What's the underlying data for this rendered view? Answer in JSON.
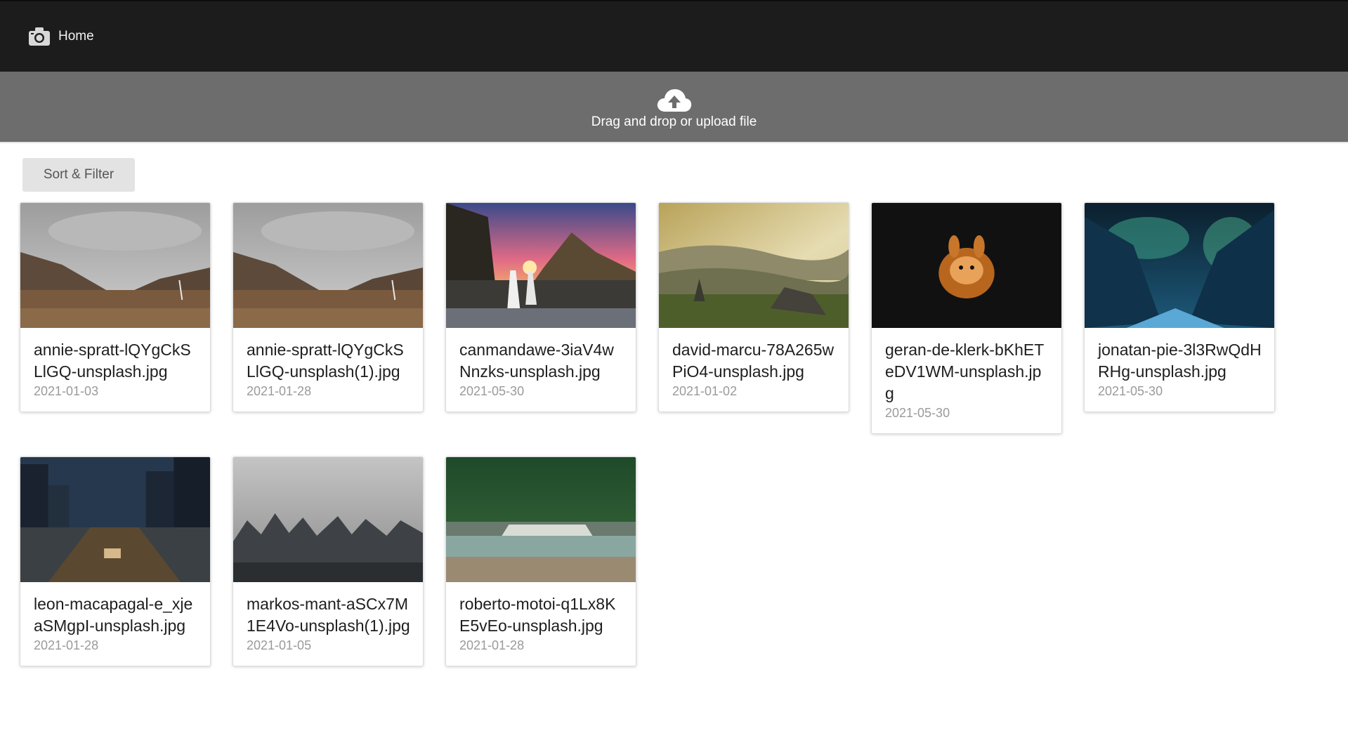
{
  "topbar": {
    "home_label": "Home",
    "icon": "camera-icon"
  },
  "upload": {
    "label": "Drag and drop or upload file",
    "icon": "cloud-upload-icon"
  },
  "toolbar": {
    "sort_filter_label": "Sort & Filter"
  },
  "files": [
    {
      "name": "annie-spratt-lQYgCkSLlGQ-unsplash.jpg",
      "date": "2021-01-03"
    },
    {
      "name": "annie-spratt-lQYgCkSLlGQ-unsplash(1).jpg",
      "date": "2021-01-28"
    },
    {
      "name": "canmandawe-3iaV4wNnzks-unsplash.jpg",
      "date": "2021-05-30"
    },
    {
      "name": "david-marcu-78A265wPiO4-unsplash.jpg",
      "date": "2021-01-02"
    },
    {
      "name": "geran-de-klerk-bKhETeDV1WM-unsplash.jpg",
      "date": "2021-05-30"
    },
    {
      "name": "jonatan-pie-3l3RwQdHRHg-unsplash.jpg",
      "date": "2021-05-30"
    },
    {
      "name": "leon-macapagal-e_xjeaSMgpI-unsplash.jpg",
      "date": "2021-01-28"
    },
    {
      "name": "markos-mant-aSCx7M1E4Vo-unsplash(1).jpg",
      "date": "2021-01-05"
    },
    {
      "name": "roberto-motoi-q1Lx8KE5vEo-unsplash.jpg",
      "date": "2021-01-28"
    }
  ]
}
